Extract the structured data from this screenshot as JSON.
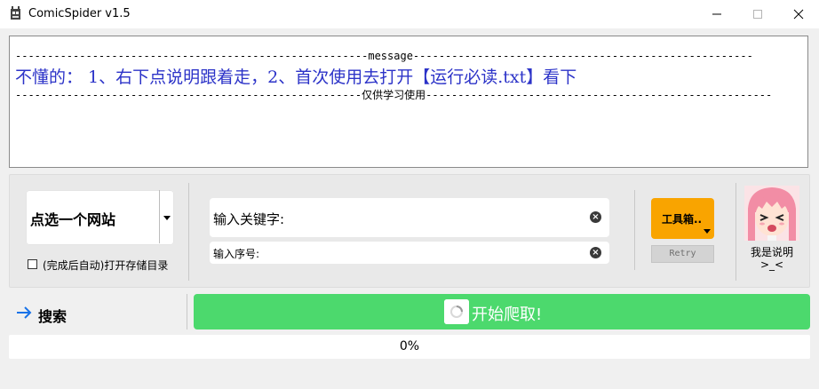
{
  "window": {
    "title": "ComicSpider v1.5",
    "icon": "spider-app-icon"
  },
  "message": {
    "header_line": "-------------------------------------------------------message-----------------------------------------------------",
    "hint_line": "不懂的： 1、右下点说明跟着走，2、首次使用去打开【运行必读.txt】看下",
    "footer_line": "------------------------------------------------------仅供学习使用------------------------------------------------------"
  },
  "site_select": {
    "selected": "点选一个网站"
  },
  "auto_open": {
    "label": "(完成后自动)打开存储目录",
    "checked": false
  },
  "keyword_input": {
    "placeholder": "输入关键字:"
  },
  "index_input": {
    "placeholder": "输入序号:"
  },
  "toolbox": {
    "label": "工具箱.."
  },
  "retry": {
    "label": "Retry"
  },
  "help": {
    "label": "我是说明\n>_<"
  },
  "search": {
    "label": "搜索",
    "icon": "arrow-right-icon"
  },
  "crawl": {
    "label": "开始爬取!"
  },
  "progress": {
    "value": 0,
    "text": "0%"
  },
  "colors": {
    "accent_green": "#4cd96d",
    "toolbox_orange": "#f9a400",
    "message_blue": "#2c33c8",
    "arrow_blue": "#1a73e8"
  }
}
